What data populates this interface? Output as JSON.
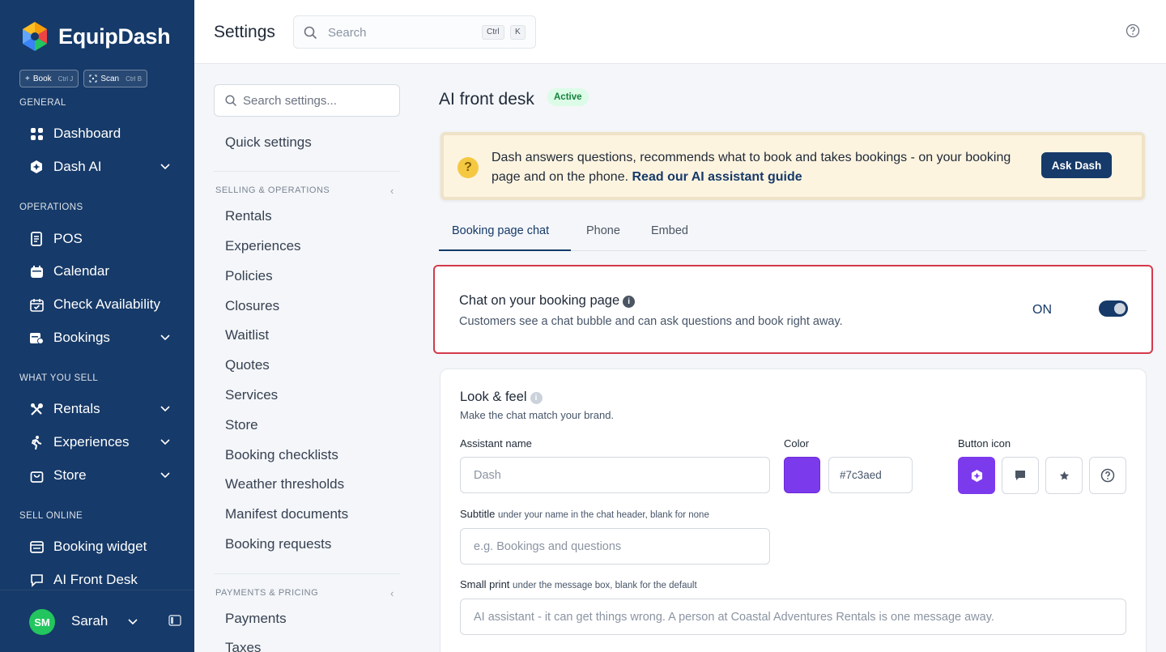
{
  "app": {
    "name": "EquipDash",
    "quick_actions": [
      {
        "label": "Book",
        "shortcut": "Ctrl J"
      },
      {
        "label": "Scan",
        "shortcut": "Ctrl B"
      }
    ]
  },
  "sidebar": {
    "sections": [
      "GENERAL",
      "OPERATIONS",
      "WHAT YOU SELL",
      "SELL ONLINE"
    ],
    "items": [
      {
        "label": "Dashboard"
      },
      {
        "label": "Dash AI"
      },
      {
        "label": "POS"
      },
      {
        "label": "Calendar"
      },
      {
        "label": "Check Availability"
      },
      {
        "label": "Bookings"
      },
      {
        "label": "Rentals"
      },
      {
        "label": "Experiences"
      },
      {
        "label": "Store"
      },
      {
        "label": "Booking widget"
      },
      {
        "label": "AI Front Desk"
      }
    ],
    "user": {
      "initials": "SM",
      "name": "Sarah"
    }
  },
  "topbar": {
    "title": "Settings",
    "search_placeholder": "Search",
    "shortcut_keys": [
      "Ctrl",
      "K"
    ]
  },
  "settings_nav": {
    "search_placeholder": "Search settings...",
    "quick_settings": "Quick settings",
    "sections": [
      {
        "title": "SELLING & OPERATIONS",
        "items": [
          "Rentals",
          "Experiences",
          "Policies",
          "Closures",
          "Waitlist",
          "Quotes",
          "Services",
          "Store",
          "Booking checklists",
          "Weather thresholds",
          "Manifest documents",
          "Booking requests"
        ]
      },
      {
        "title": "PAYMENTS & PRICING",
        "items": [
          "Payments",
          "Taxes"
        ]
      }
    ]
  },
  "main": {
    "title": "AI front desk",
    "status": "Active",
    "banner": {
      "text": "Dash answers questions, recommends what to book and takes bookings - on your booking page and on the phone.",
      "link": "Read our AI assistant guide",
      "button": "Ask Dash",
      "icon": "question-icon"
    },
    "tabs": [
      "Booking page chat",
      "Phone",
      "Embed"
    ],
    "active_tab": 0,
    "chat_toggle": {
      "title": "Chat on your booking page",
      "description": "Customers see a chat bubble and can ask questions and book right away.",
      "state_label": "ON",
      "enabled": true
    },
    "look_feel": {
      "title": "Look & feel",
      "subtitle": "Make the chat match your brand.",
      "assistant_name_label": "Assistant name",
      "assistant_name_value": "Dash",
      "color_label": "Color",
      "color_value": "#7c3aed",
      "button_icon_label": "Button icon",
      "button_icons": [
        "ai-hex-icon",
        "chat-bubble-icon",
        "star-icon",
        "question-circle-icon"
      ],
      "selected_icon": 0,
      "subtitle_label": "Subtitle",
      "subtitle_hint": "under your name in the chat header, blank for none",
      "subtitle_placeholder": "e.g. Bookings and questions",
      "small_print_label": "Small print",
      "small_print_hint": "under the message box, blank for the default",
      "small_print_placeholder": "AI assistant - it can get things wrong. A person at Coastal Adventures Rentals is one message away."
    }
  },
  "colors": {
    "sidebar_bg": "#163a69",
    "accent": "#163a69",
    "brand_purple": "#7c3aed",
    "highlight_border": "#d43a4b",
    "banner_bg": "#fdf4e0",
    "active_badge_bg": "#dcfce7"
  }
}
